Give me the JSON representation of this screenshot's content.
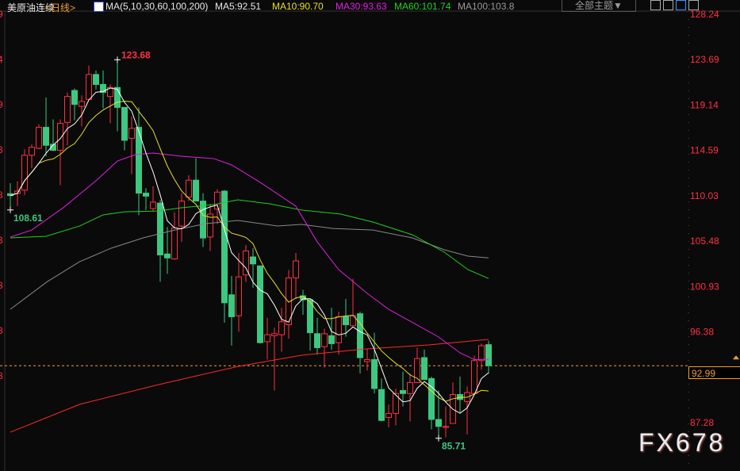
{
  "header": {
    "instrument": "美原油连续",
    "period": "<日线>",
    "ma_params": "MA(5,10,30,60,100,200)",
    "ma5": "MA5:92.51",
    "ma10": "MA10:90.70",
    "ma30": "MA30:93.63",
    "ma60": "MA60:101.74",
    "ma100": "MA100:103.8",
    "theme_button": "全部主题▼"
  },
  "colors": {
    "up": "#ff3040",
    "down": "#3cc880",
    "ma5": "#ffffff",
    "ma10": "#e8e020",
    "ma30": "#e020e0",
    "ma60": "#20d020",
    "ma100": "#888888",
    "ma200": "#ff2828",
    "axis_text": "#ff3040",
    "last_price": "#f0a030"
  },
  "current_price": "92.99",
  "watermark": "FX678",
  "chart_data": {
    "type": "candlestick",
    "title": "美原油连续 日线",
    "ylim": [
      85.2,
      128.24
    ],
    "y_ticks": [
      "128.24",
      "123.69",
      "119.14",
      "114.59",
      "110.03",
      "105.48",
      "100.93",
      "96.38",
      "87.28"
    ],
    "left_axis_fragments": [
      "9",
      "4",
      "9",
      "3",
      "8",
      "3",
      "8",
      "3",
      "8"
    ],
    "annotations": {
      "high": "123.68",
      "high_index": 15,
      "low": "85.71",
      "low_index": 60,
      "start_low": "108.61",
      "start_low_index": 0
    },
    "ohlc": [
      [
        110.24,
        111.3,
        108.61,
        110.05
      ],
      [
        110.26,
        111.5,
        109.0,
        110.5
      ],
      [
        110.6,
        114.7,
        110.1,
        114.1
      ],
      [
        114.1,
        115.2,
        112.8,
        114.9
      ],
      [
        114.8,
        117.2,
        114.7,
        116.9
      ],
      [
        116.9,
        119.9,
        114.0,
        115.1
      ],
      [
        115.2,
        117.7,
        114.5,
        114.6
      ],
      [
        114.6,
        117.7,
        111.1,
        117.3
      ],
      [
        117.4,
        120.4,
        115.1,
        120.0
      ],
      [
        120.6,
        120.8,
        117.6,
        119.2
      ],
      [
        119.0,
        120.1,
        117.0,
        119.5
      ],
      [
        119.7,
        123.1,
        119.7,
        122.2
      ],
      [
        122.2,
        122.6,
        120.7,
        121.2
      ],
      [
        121.2,
        122.6,
        118.8,
        120.4
      ],
      [
        120.0,
        121.2,
        117.3,
        120.9
      ],
      [
        120.9,
        123.68,
        116.5,
        118.9
      ],
      [
        118.9,
        118.9,
        114.6,
        115.6
      ],
      [
        115.8,
        118.0,
        112.2,
        116.8
      ],
      [
        116.9,
        118.9,
        108.1,
        110.3
      ],
      [
        110.3,
        110.8,
        108.6,
        110.0
      ],
      [
        108.75,
        111.0,
        108.5,
        109.4
      ],
      [
        109.3,
        109.6,
        101.4,
        104.1
      ],
      [
        104.2,
        106.9,
        102.2,
        103.8
      ],
      [
        103.7,
        108.4,
        103.6,
        106.8
      ],
      [
        107.0,
        110.3,
        105.4,
        109.5
      ],
      [
        109.9,
        112.1,
        109.5,
        111.6
      ],
      [
        111.6,
        113.8,
        109.5,
        109.5
      ],
      [
        109.5,
        110.3,
        104.9,
        105.8
      ],
      [
        105.9,
        109.2,
        104.5,
        108.2
      ],
      [
        108.7,
        110.7,
        107.2,
        110.4
      ],
      [
        110.5,
        110.6,
        97.3,
        99.3
      ],
      [
        100.1,
        102.0,
        95.0,
        97.9
      ],
      [
        98.0,
        104.3,
        96.4,
        101.9
      ],
      [
        102.1,
        105.1,
        101.4,
        104.5
      ],
      [
        103.9,
        104.8,
        100.8,
        103.2
      ],
      [
        103.0,
        103.0,
        95.2,
        95.3
      ],
      [
        95.4,
        97.8,
        93.6,
        96.1
      ],
      [
        96.0,
        96.8,
        90.5,
        96.2
      ],
      [
        96.1,
        98.8,
        94.4,
        97.4
      ],
      [
        97.1,
        102.6,
        95.7,
        101.8
      ],
      [
        101.8,
        104.3,
        99.7,
        103.5
      ],
      [
        100.0,
        100.6,
        98.1,
        99.6
      ],
      [
        99.6,
        99.6,
        94.5,
        96.3
      ],
      [
        96.2,
        97.8,
        94.1,
        94.8
      ],
      [
        94.9,
        96.7,
        92.8,
        96.2
      ],
      [
        96.0,
        98.8,
        94.6,
        95.2
      ],
      [
        95.3,
        98.4,
        94.1,
        97.9
      ],
      [
        97.9,
        99.7,
        95.9,
        97.1
      ],
      [
        97.0,
        101.7,
        97.0,
        98.0
      ],
      [
        98.2,
        98.4,
        92.2,
        93.8
      ],
      [
        93.4,
        94.7,
        92.5,
        93.6
      ],
      [
        93.6,
        96.3,
        90.2,
        90.7
      ],
      [
        90.6,
        91.7,
        87.4,
        87.5
      ],
      [
        87.8,
        89.1,
        86.8,
        88.2
      ],
      [
        88.2,
        90.7,
        87.0,
        90.2
      ],
      [
        90.5,
        92.4,
        88.9,
        90.2
      ],
      [
        90.2,
        92.2,
        87.4,
        91.3
      ],
      [
        91.3,
        94.8,
        91.3,
        93.7
      ],
      [
        93.8,
        94.6,
        91.6,
        91.6
      ],
      [
        91.7,
        91.9,
        86.6,
        87.6
      ],
      [
        87.6,
        90.5,
        85.71,
        86.9
      ],
      [
        86.8,
        88.9,
        85.8,
        86.9
      ],
      [
        87.2,
        91.3,
        87.2,
        90.1
      ],
      [
        90.1,
        91.9,
        88.3,
        89.6
      ],
      [
        89.4,
        90.9,
        86.1,
        90.3
      ],
      [
        90.2,
        94.0,
        90.2,
        93.5
      ],
      [
        93.5,
        95.2,
        92.6,
        95.0
      ],
      [
        95.1,
        95.5,
        92.2,
        92.99
      ]
    ],
    "ma_lines": {
      "ma30": {
        "idx": [
          0,
          3,
          7.4,
          12,
          15,
          17.5,
          20,
          24,
          28.5,
          31,
          35,
          40,
          43,
          46,
          50,
          53,
          56,
          60,
          63,
          65,
          67
        ],
        "val": [
          105.89,
          106.6,
          108.83,
          111.54,
          113.52,
          114.16,
          114.32,
          114.0,
          113.76,
          113.13,
          111.38,
          108.99,
          105.41,
          102.63,
          100.24,
          98.65,
          97.46,
          95.87,
          94.28,
          93.6,
          93.63
        ]
      },
      "ma60": {
        "idx": [
          0,
          5,
          9.7,
          13,
          16,
          20.6,
          24,
          28.5,
          31.9,
          36.3,
          40.8,
          46.3,
          50.8,
          56.3,
          60.8,
          64.1,
          67
        ],
        "val": [
          105.81,
          105.97,
          107.0,
          108.12,
          108.43,
          108.51,
          108.83,
          109.15,
          109.63,
          109.23,
          108.6,
          108.2,
          107.4,
          106.13,
          104.38,
          102.63,
          101.74
        ]
      },
      "ma100": {
        "idx": [
          0,
          5.2,
          9.7,
          14.1,
          18.6,
          23,
          27.4,
          31.9,
          37.4,
          40.8,
          45.2,
          50.8,
          56.3,
          60.8,
          64.1,
          67
        ],
        "val": [
          98.65,
          101.43,
          103.42,
          104.77,
          105.81,
          106.6,
          107.24,
          107.56,
          107.0,
          107.16,
          106.76,
          106.6,
          105.81,
          104.62,
          103.98,
          103.8
        ]
      },
      "ma200": {
        "idx": [
          0,
          9.7,
          20.8,
          31.9,
          40.8,
          49.7,
          58.6,
          67
        ],
        "val": [
          86.32,
          89.11,
          91.1,
          92.92,
          94.04,
          94.67,
          95.07,
          95.63
        ]
      }
    }
  }
}
